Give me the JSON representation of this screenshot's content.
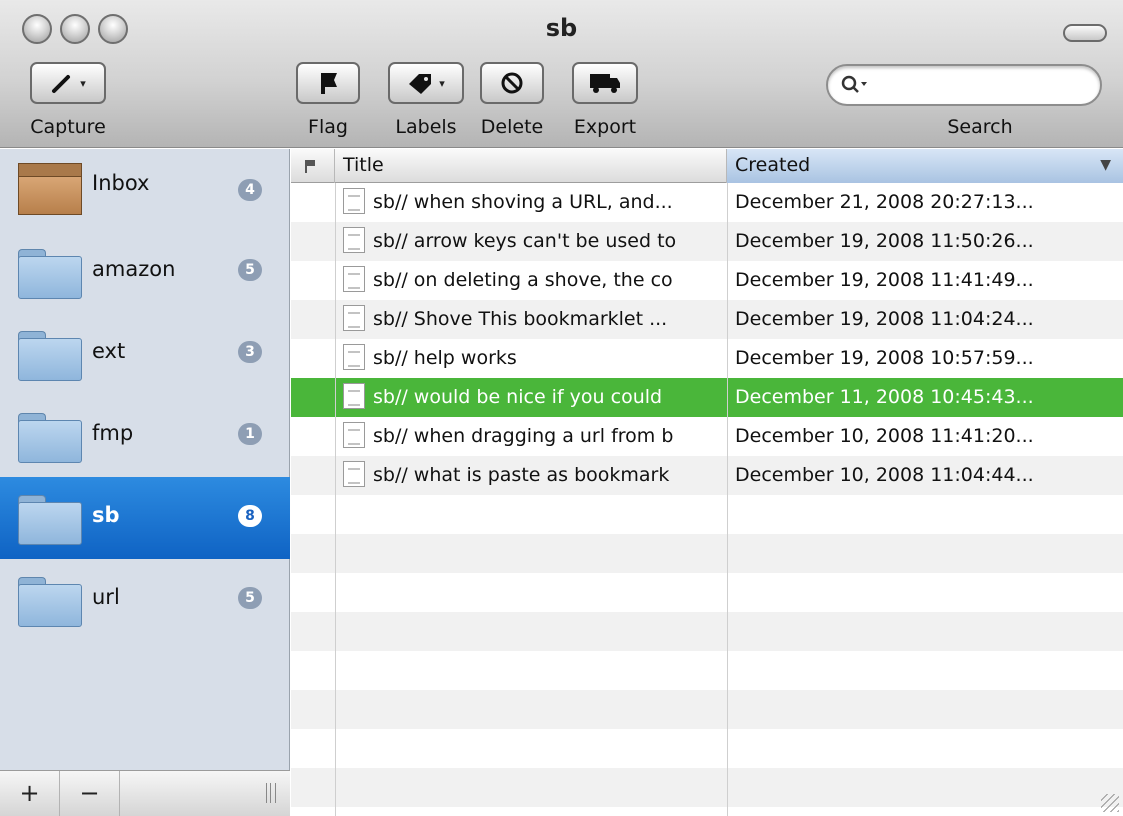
{
  "window": {
    "title": "sb"
  },
  "toolbar": {
    "capture_label": "Capture",
    "flag_label": "Flag",
    "labels_label": "Labels",
    "delete_label": "Delete",
    "export_label": "Export",
    "search_label": "Search",
    "search_placeholder": ""
  },
  "sidebar": {
    "items": [
      {
        "label": "Inbox",
        "count": "4",
        "icon": "inbox-icon"
      },
      {
        "label": "amazon",
        "count": "5",
        "icon": "folder-icon"
      },
      {
        "label": "ext",
        "count": "3",
        "icon": "folder-icon"
      },
      {
        "label": "fmp",
        "count": "1",
        "icon": "folder-icon"
      },
      {
        "label": "sb",
        "count": "8",
        "icon": "folder-icon",
        "selected": true
      },
      {
        "label": "url",
        "count": "5",
        "icon": "folder-icon"
      }
    ],
    "footer": {
      "add_label": "+",
      "remove_label": "−"
    }
  },
  "list": {
    "headers": {
      "title": "Title",
      "created": "Created"
    },
    "rows": [
      {
        "title": "sb// when shoving a URL, and...",
        "created": "December 21, 2008 20:27:13..."
      },
      {
        "title": "sb// arrow keys can't be used to",
        "created": "December 19, 2008 11:50:26..."
      },
      {
        "title": "sb// on deleting a shove, the co",
        "created": "December 19, 2008 11:41:49..."
      },
      {
        "title": "sb// Shove This bookmarklet ...",
        "created": "December 19, 2008 11:04:24..."
      },
      {
        "title": "sb// help works",
        "created": "December 19, 2008 10:57:59..."
      },
      {
        "title": "sb// would be nice if you could",
        "created": "December 11, 2008 10:45:43...",
        "selected": true
      },
      {
        "title": "sb// when dragging a url from b",
        "created": "December 10, 2008 11:41:20..."
      },
      {
        "title": "sb// what is paste as bookmark",
        "created": "December 10, 2008 11:04:44..."
      }
    ]
  },
  "colors": {
    "selected_sidebar": "#1a6fd0",
    "selected_row": "#4ab63a",
    "sidebar_bg": "#d7dee8"
  }
}
